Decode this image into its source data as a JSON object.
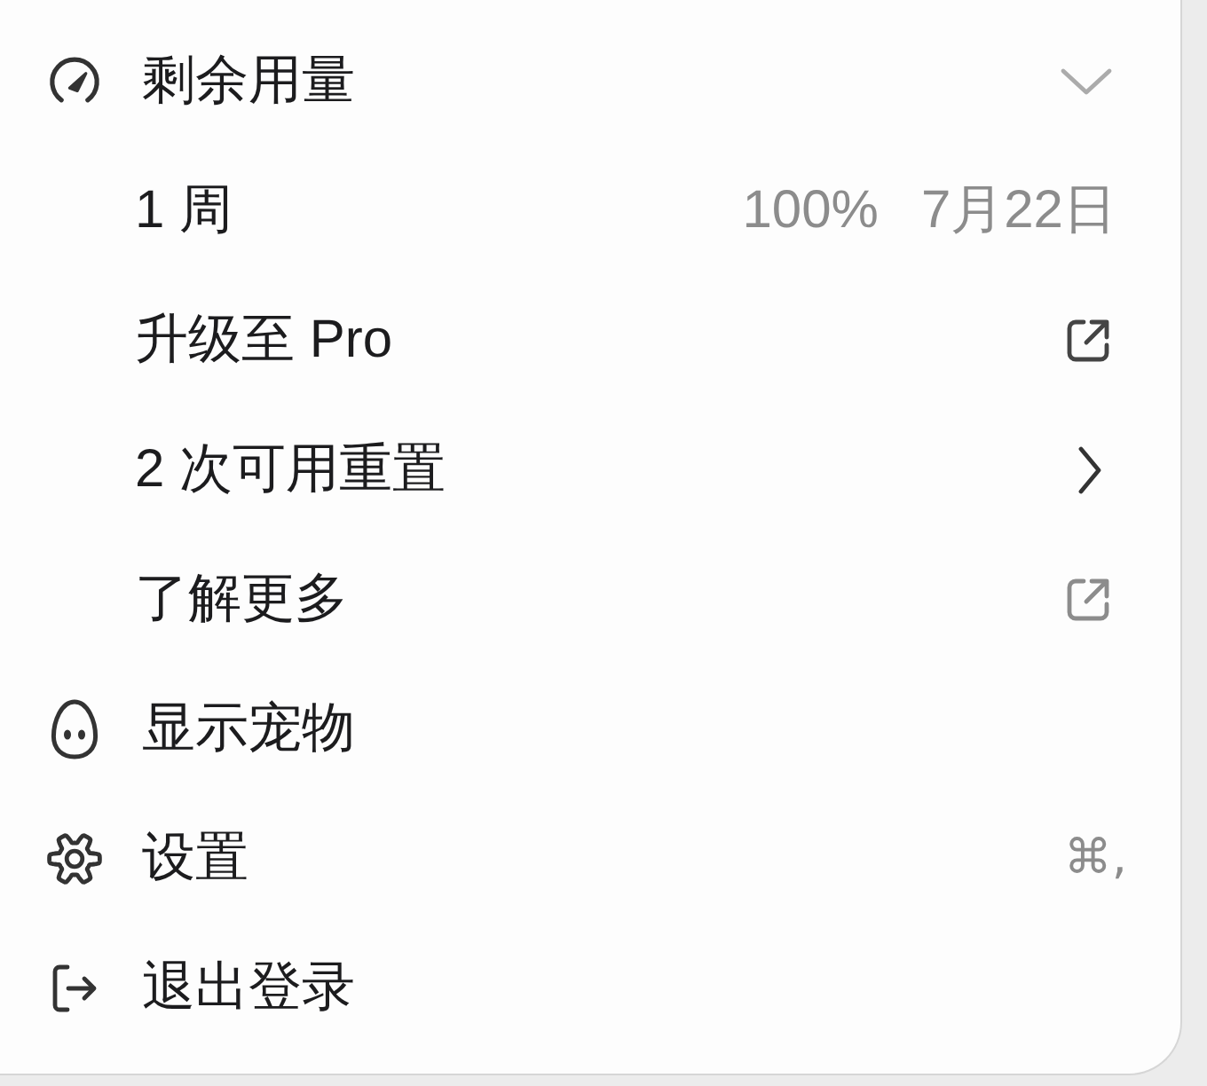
{
  "menu": {
    "items": [
      {
        "kind": "usage",
        "label": "剩余用量",
        "expanded": true,
        "children": [
          {
            "kind": "quota",
            "label": "1 周",
            "percent": "100%",
            "date": "7月22日"
          },
          {
            "kind": "external",
            "label": "升级至 Pro"
          },
          {
            "kind": "submenu",
            "label": "2 次可用重置"
          },
          {
            "kind": "external",
            "label": "了解更多"
          }
        ]
      },
      {
        "kind": "pet",
        "label": "显示宠物"
      },
      {
        "kind": "settings",
        "label": "设置",
        "shortcut": "⌘,"
      },
      {
        "kind": "logout",
        "label": "退出登录"
      }
    ]
  }
}
